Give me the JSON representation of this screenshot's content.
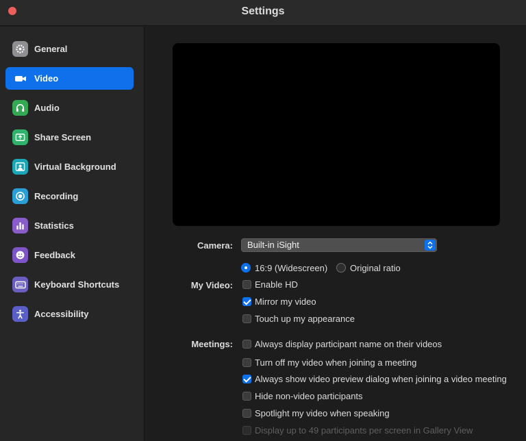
{
  "window": {
    "title": "Settings"
  },
  "sidebar": {
    "items": [
      {
        "label": "General",
        "icon": "gear-icon",
        "color": "#8e8e93",
        "active": false
      },
      {
        "label": "Video",
        "icon": "video-camera-icon",
        "color": "#0e71eb",
        "active": true
      },
      {
        "label": "Audio",
        "icon": "headphones-icon",
        "color": "#34a853",
        "active": false
      },
      {
        "label": "Share Screen",
        "icon": "share-screen-icon",
        "color": "#2fb26a",
        "active": false
      },
      {
        "label": "Virtual Background",
        "icon": "person-background-icon",
        "color": "#1aa6b7",
        "active": false
      },
      {
        "label": "Recording",
        "icon": "record-icon",
        "color": "#2a9fd6",
        "active": false
      },
      {
        "label": "Statistics",
        "icon": "bar-chart-icon",
        "color": "#8a5cc9",
        "active": false
      },
      {
        "label": "Feedback",
        "icon": "smiley-icon",
        "color": "#7e55c6",
        "active": false
      },
      {
        "label": "Keyboard Shortcuts",
        "icon": "keyboard-icon",
        "color": "#6a5fc1",
        "active": false
      },
      {
        "label": "Accessibility",
        "icon": "accessibility-icon",
        "color": "#5a5fc7",
        "active": false
      }
    ]
  },
  "video": {
    "camera_label": "Camera:",
    "camera_value": "Built-in iSight",
    "my_video_label": "My Video:",
    "ratio_widescreen": "16:9 (Widescreen)",
    "ratio_original": "Original ratio",
    "enable_hd": "Enable HD",
    "mirror": "Mirror my video",
    "touch_up": "Touch up my appearance",
    "meetings_label": "Meetings:",
    "opt_display_name": "Always display participant name on their videos",
    "opt_turn_off": "Turn off my video when joining a meeting",
    "opt_preview_dialog": "Always show video preview dialog when joining a video meeting",
    "opt_hide_nonvideo": "Hide non-video participants",
    "opt_spotlight": "Spotlight my video when speaking",
    "opt_49": "Display up to 49 participants per screen in Gallery View"
  }
}
